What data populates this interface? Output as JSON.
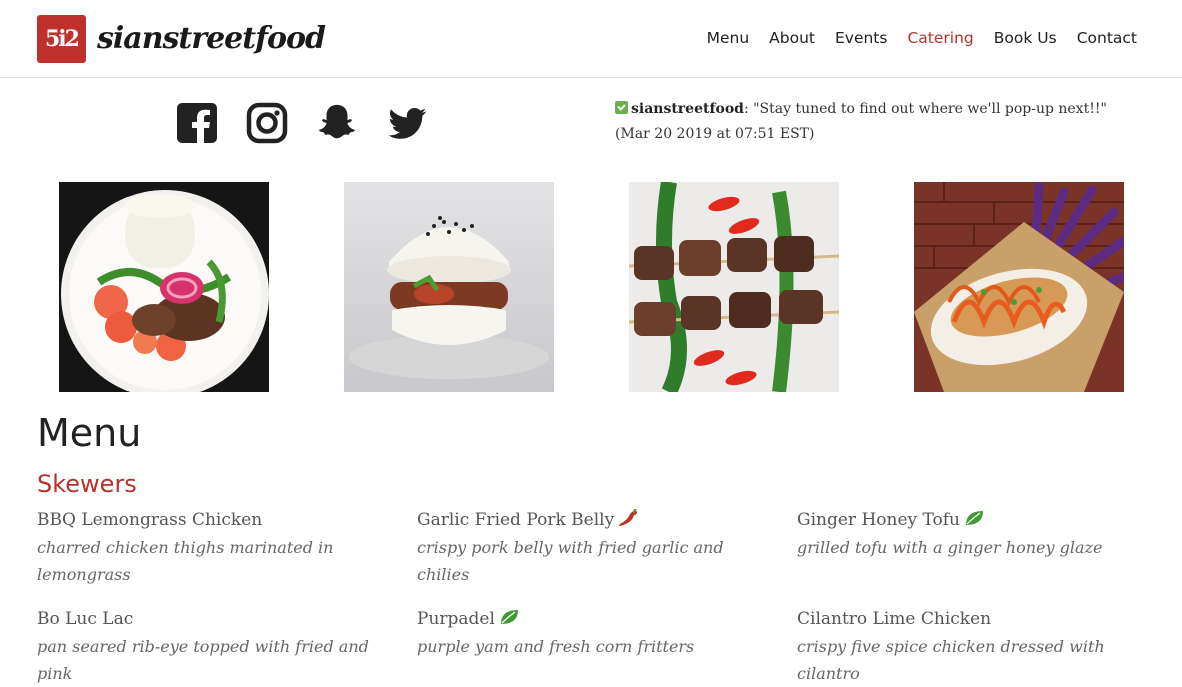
{
  "header": {
    "logo_mark": "5i2",
    "logo_text": "sianstreetfood",
    "nav": [
      {
        "label": "Menu"
      },
      {
        "label": "About"
      },
      {
        "label": "Events"
      },
      {
        "label": "Catering",
        "active": true
      },
      {
        "label": "Book Us"
      },
      {
        "label": "Contact"
      }
    ]
  },
  "social": {
    "icons": [
      "facebook-icon",
      "instagram-icon",
      "snapchat-icon",
      "twitter-icon"
    ],
    "icon_color": "#222222"
  },
  "tweet": {
    "handle": "sianstreetfood",
    "text": ": \"Stay tuned to find out where we'll pop-up next!!\" (Mar 20 2019 at 07:51 EST)"
  },
  "photos": [
    {
      "subject": "rice plate with pickled onion and beef"
    },
    {
      "subject": "rice burger"
    },
    {
      "subject": "beef skewers with chilies"
    },
    {
      "subject": "bao with purple fries"
    }
  ],
  "menu": {
    "title": "Menu",
    "sections": [
      {
        "title": "Skewers",
        "items": [
          {
            "name": "BBQ Lemongrass Chicken",
            "description": "charred chicken thighs marinated in lemongrass",
            "tag": ""
          },
          {
            "name": "Garlic Fried Pork Belly",
            "description": "crispy pork belly with fried garlic and chilies",
            "tag": "spicy"
          },
          {
            "name": "Ginger Honey Tofu",
            "description": "grilled tofu with a ginger honey glaze",
            "tag": "vegetarian"
          },
          {
            "name": "Bo Luc Lac",
            "description": "pan seared rib-eye topped with fried and pink",
            "tag": ""
          },
          {
            "name": "Purpadel",
            "description": "purple yam and fresh corn fritters",
            "tag": "vegetarian"
          },
          {
            "name": "Cilantro Lime Chicken",
            "description": "crispy five spice chicken dressed with cilantro",
            "tag": ""
          }
        ]
      }
    ]
  },
  "colors": {
    "accent": "#b3322e",
    "vegetarian": "#3f9a33",
    "spicy": "#c62d23"
  }
}
